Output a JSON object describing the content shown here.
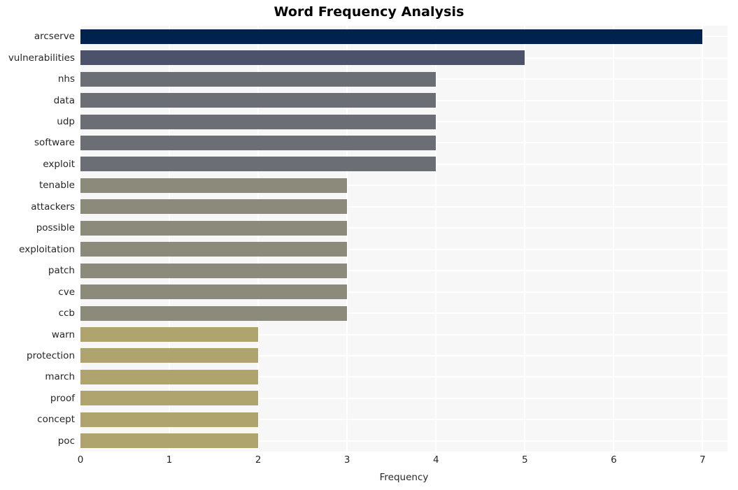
{
  "chart_data": {
    "type": "bar",
    "orientation": "horizontal",
    "title": "Word Frequency Analysis",
    "xlabel": "Frequency",
    "ylabel": "",
    "categories": [
      "arcserve",
      "vulnerabilities",
      "nhs",
      "data",
      "udp",
      "software",
      "exploit",
      "tenable",
      "attackers",
      "possible",
      "exploitation",
      "patch",
      "cve",
      "ccb",
      "warn",
      "protection",
      "march",
      "proof",
      "concept",
      "poc"
    ],
    "values": [
      7,
      5,
      4,
      4,
      4,
      4,
      4,
      3,
      3,
      3,
      3,
      3,
      3,
      3,
      2,
      2,
      2,
      2,
      2,
      2
    ],
    "bar_colors": [
      "#00224e",
      "#4b5269",
      "#6b6e74",
      "#6b6e74",
      "#6b6e74",
      "#6b6e74",
      "#6b6e74",
      "#8c8a7a",
      "#8c8a7a",
      "#8c8a7a",
      "#8c8a7a",
      "#8c8a7a",
      "#8c8a7a",
      "#8c8a7a",
      "#b0a46e",
      "#b0a46e",
      "#b0a46e",
      "#b0a46e",
      "#b0a46e",
      "#b0a46e"
    ],
    "xlim": [
      0,
      7.28
    ],
    "xticks": [
      0,
      1,
      2,
      3,
      4,
      5,
      6,
      7
    ],
    "xtick_labels": [
      "0",
      "1",
      "2",
      "3",
      "4",
      "5",
      "6",
      "7"
    ],
    "grid": true,
    "grid_color": "#ffffff",
    "plot_background": "#f7f7f7",
    "figure_background": "#ffffff",
    "legend": null
  }
}
